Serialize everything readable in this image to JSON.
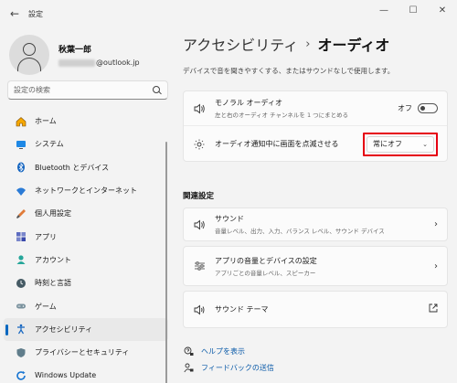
{
  "window": {
    "title": "設定",
    "back_glyph": "←",
    "minimize_glyph": "—",
    "maximize_glyph": "☐",
    "close_glyph": "✕"
  },
  "profile": {
    "name": "秋葉一郎",
    "email_domain": "@outlook.jp"
  },
  "search": {
    "placeholder": "設定の検索"
  },
  "nav": {
    "items": [
      {
        "label": "ホーム",
        "icon": "home-icon",
        "active": false
      },
      {
        "label": "システム",
        "icon": "system-icon",
        "active": false
      },
      {
        "label": "Bluetooth とデバイス",
        "icon": "bluetooth-icon",
        "active": false
      },
      {
        "label": "ネットワークとインターネット",
        "icon": "network-icon",
        "active": false
      },
      {
        "label": "個人用設定",
        "icon": "personalize-icon",
        "active": false
      },
      {
        "label": "アプリ",
        "icon": "apps-icon",
        "active": false
      },
      {
        "label": "アカウント",
        "icon": "account-icon",
        "active": false
      },
      {
        "label": "時刻と言語",
        "icon": "time-language-icon",
        "active": false
      },
      {
        "label": "ゲーム",
        "icon": "gaming-icon",
        "active": false
      },
      {
        "label": "アクセシビリティ",
        "icon": "accessibility-icon",
        "active": true
      },
      {
        "label": "プライバシーとセキュリティ",
        "icon": "shield-icon",
        "active": false
      },
      {
        "label": "Windows Update",
        "icon": "windows-update-icon",
        "active": false
      }
    ]
  },
  "main": {
    "breadcrumb_parent": "アクセシビリティ",
    "breadcrumb_sep": "›",
    "breadcrumb_current": "オーディオ",
    "description": "デバイスで音を聞きやすくする、またはサウンドなしで使用します。",
    "mono": {
      "title": "モノラル オーディオ",
      "subtitle": "左と右のオーディオ チャンネルを 1 つにまとめる",
      "toggle_label": "オフ"
    },
    "flash": {
      "title": "オーディオ通知中に画面を点滅させる",
      "selected": "常にオフ"
    },
    "related_title": "関連設定",
    "sound": {
      "title": "サウンド",
      "subtitle": "音量レベル、出力、入力、バランス レベル、サウンド デバイス"
    },
    "app_volume": {
      "title": "アプリの音量とデバイスの設定",
      "subtitle": "アプリごとの音量レベル、スピーカー"
    },
    "sound_theme": {
      "title": "サウンド テーマ"
    },
    "help_label": "ヘルプを表示",
    "feedback_label": "フィードバックの送信"
  },
  "colors": {
    "accent": "#0067c0",
    "highlight": "#e60012"
  }
}
